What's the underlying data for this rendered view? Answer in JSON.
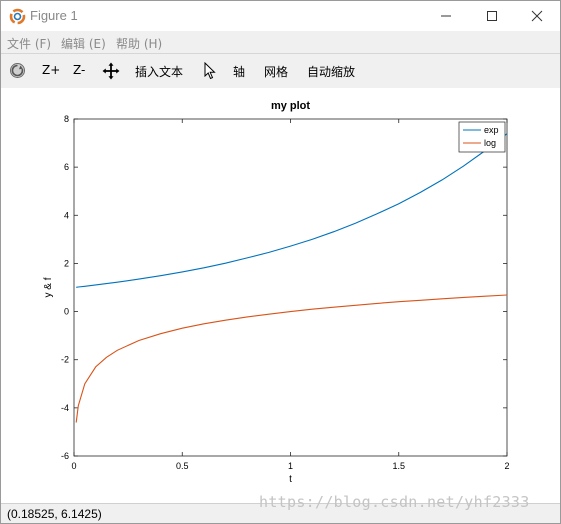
{
  "window": {
    "title": "Figure 1"
  },
  "menubar": {
    "file": "文件 (F)",
    "edit": "编辑 (E)",
    "help": "帮助 (H)"
  },
  "toolbar": {
    "zoom_in": "Z+",
    "zoom_out": "Z-",
    "insert_text": "插入文本",
    "axis": "轴",
    "grid": "网格",
    "autoscale": "自动缩放"
  },
  "status": {
    "coords": "(0.18525, 6.1425)",
    "watermark": "https://blog.csdn.net/yhf2333"
  },
  "colors": {
    "exp": "#0072BD",
    "log": "#D95319"
  },
  "chart_data": {
    "type": "line",
    "title": "my plot",
    "xlabel": "t",
    "ylabel": "y & f",
    "xlim": [
      0,
      2
    ],
    "ylim": [
      -6,
      8
    ],
    "xticks": [
      0,
      0.5,
      1,
      1.5,
      2
    ],
    "xtick_labels": [
      "0",
      "0.5",
      "1",
      "1.5",
      "2"
    ],
    "yticks": [
      -6,
      -4,
      -2,
      0,
      2,
      4,
      6,
      8
    ],
    "ytick_labels": [
      "-6",
      "-4",
      "-2",
      "0",
      "2",
      "4",
      "6",
      "8"
    ],
    "grid": false,
    "legend_position": "top-right",
    "x": [
      0.01,
      0.02,
      0.05,
      0.1,
      0.15,
      0.2,
      0.3,
      0.4,
      0.5,
      0.6,
      0.7,
      0.8,
      0.9,
      1.0,
      1.1,
      1.2,
      1.3,
      1.4,
      1.5,
      1.6,
      1.7,
      1.8,
      1.9,
      2.0
    ],
    "series": [
      {
        "name": "exp",
        "color": "#0072BD",
        "y": [
          1.01,
          1.02,
          1.05,
          1.11,
          1.16,
          1.22,
          1.35,
          1.49,
          1.65,
          1.82,
          2.01,
          2.23,
          2.46,
          2.72,
          3.0,
          3.32,
          3.67,
          4.06,
          4.48,
          4.95,
          5.47,
          6.05,
          6.69,
          7.39
        ]
      },
      {
        "name": "log",
        "color": "#D95319",
        "y": [
          -4.61,
          -3.91,
          -3.0,
          -2.3,
          -1.9,
          -1.61,
          -1.2,
          -0.92,
          -0.69,
          -0.51,
          -0.36,
          -0.22,
          -0.11,
          0.0,
          0.1,
          0.18,
          0.26,
          0.34,
          0.41,
          0.47,
          0.53,
          0.59,
          0.64,
          0.69
        ]
      }
    ]
  }
}
